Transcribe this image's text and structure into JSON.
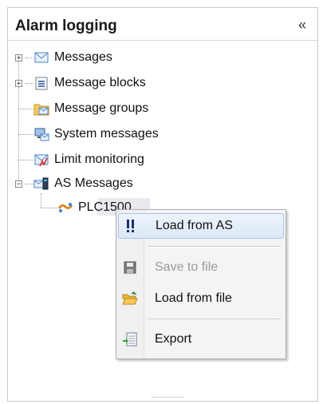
{
  "panel": {
    "title": "Alarm logging",
    "collapse_icon": "«"
  },
  "tree": {
    "items": [
      {
        "label": "Messages",
        "icon": "envelope-icon",
        "expandable": true
      },
      {
        "label": "Message blocks",
        "icon": "list-icon",
        "expandable": true
      },
      {
        "label": "Message groups",
        "icon": "folder-envelope-icon",
        "expandable": false
      },
      {
        "label": "System messages",
        "icon": "computer-icon",
        "expandable": false
      },
      {
        "label": "Limit monitoring",
        "icon": "limit-envelope-icon",
        "expandable": false
      },
      {
        "label": "AS Messages",
        "icon": "as-messages-icon",
        "expandable": true,
        "expanded": true
      },
      {
        "label": "PLC1500",
        "icon": "plc-icon",
        "child": true
      }
    ]
  },
  "context_menu": {
    "items": [
      {
        "label": "Load from AS",
        "icon": "exclamation-icon",
        "state": "hover"
      },
      {
        "label": "Save to file",
        "icon": "save-icon",
        "state": "disabled"
      },
      {
        "label": "Load from file",
        "icon": "open-folder-icon",
        "state": "enabled"
      },
      {
        "label": "Export",
        "icon": "export-icon",
        "state": "enabled"
      }
    ]
  },
  "colors": {
    "menu_hover_border": "#a9c3e6",
    "panel_border": "#c2cad3"
  }
}
